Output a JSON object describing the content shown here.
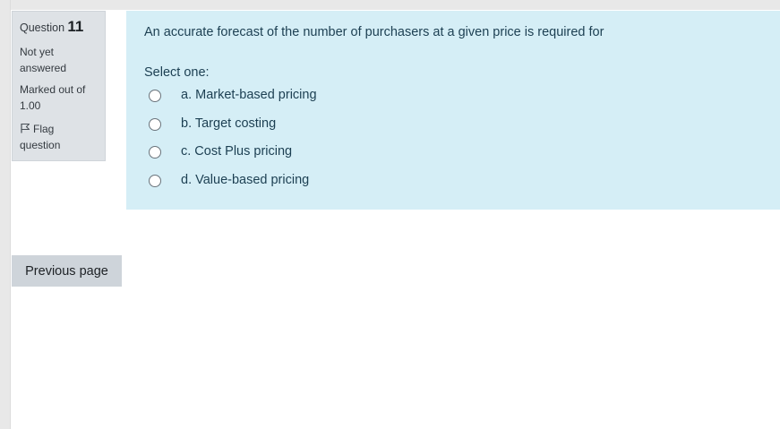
{
  "question_info": {
    "label": "Question",
    "number": "11",
    "state": "Not yet answered",
    "grade": "Marked out of 1.00",
    "flag_label": "Flag question"
  },
  "question": {
    "text": "An accurate forecast of the number of purchasers at a given price is required for",
    "prompt": "Select one:",
    "answers": [
      {
        "label": "a. Market-based pricing",
        "selected": false
      },
      {
        "label": "b. Target costing",
        "selected": false
      },
      {
        "label": "c. Cost Plus pricing",
        "selected": false
      },
      {
        "label": "d. Value-based pricing",
        "selected": false
      }
    ]
  },
  "navigation": {
    "previous_label": "Previous page"
  },
  "colors": {
    "info_background": "#dee2e6",
    "content_background": "#d5eef6",
    "button_background": "#ced4da",
    "content_text": "#1c3f52"
  }
}
